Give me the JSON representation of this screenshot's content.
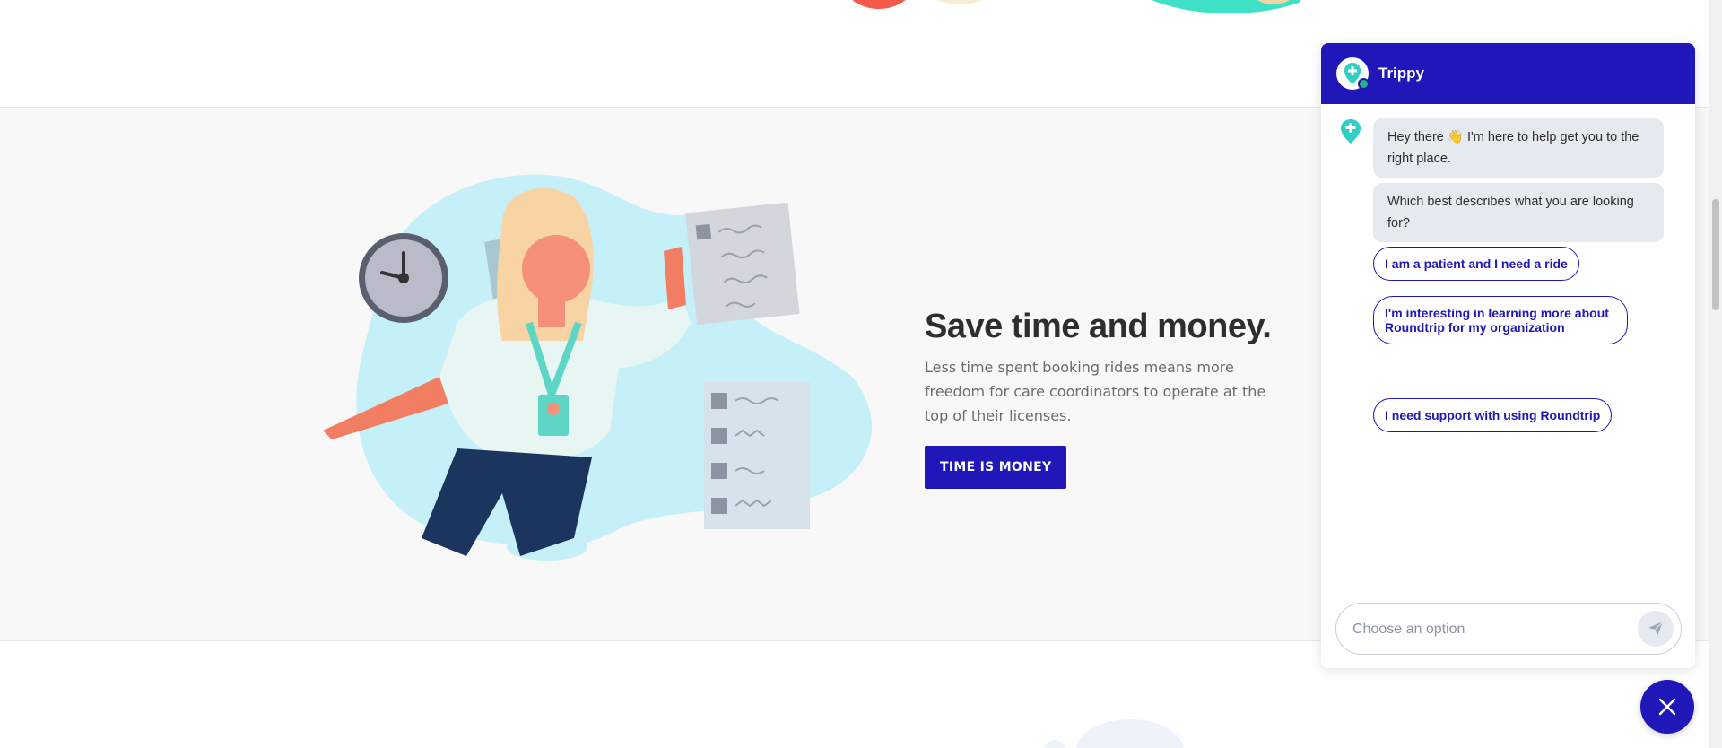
{
  "hero": {
    "title": "Save time and money.",
    "body": "Less time spent booking rides means more freedom for care coordinators to operate at the top of their licenses.",
    "cta_label": "TIME IS MONEY"
  },
  "chat": {
    "bot_name": "Trippy",
    "messages": [
      "Hey there 👋 I'm here to help get you to the right place.",
      "Which best describes what you are looking for?"
    ],
    "options": [
      "I am a patient and I need a ride",
      "I'm interesting in learning more about Roundtrip for my organization",
      "I need support with using Roundtrip"
    ],
    "input_placeholder": "Choose an option",
    "send_icon": "paper-plane-icon",
    "close_icon": "close-icon"
  },
  "colors": {
    "brand": "#1f17b8",
    "bubble": "#e5e9f0",
    "teal": "#2fcfc6",
    "section_bg": "#f8f8f8"
  }
}
